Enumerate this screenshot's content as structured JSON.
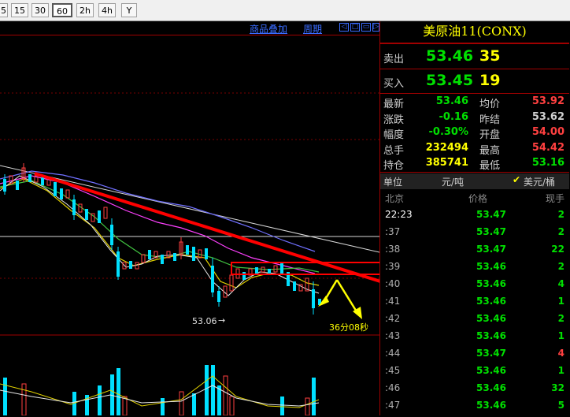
{
  "toolbar": {
    "buttons": [
      "5",
      "15",
      "30",
      "60",
      "2h",
      "4h",
      "Y"
    ],
    "active_index": 3
  },
  "chart_header": {
    "overlay_label": "商品叠加",
    "period_label": "周期"
  },
  "annotations": {
    "low_label": "53.06",
    "countdown": "36分08秒"
  },
  "panel": {
    "title": "美原油11(CONX)",
    "ask": {
      "label": "卖出",
      "price": "53.46",
      "qty": "35"
    },
    "bid": {
      "label": "买入",
      "price": "53.45",
      "qty": "19"
    },
    "stats": [
      {
        "l1": "最新",
        "v1": "53.46",
        "c1": "#00e000",
        "l2": "均价",
        "v2": "53.92",
        "c2": "#ff4040"
      },
      {
        "l1": "涨跌",
        "v1": "-0.16",
        "c1": "#00e000",
        "l2": "昨结",
        "v2": "53.62",
        "c2": "#d0d0d0"
      },
      {
        "l1": "幅度",
        "v1": "-0.30%",
        "c1": "#00e000",
        "l2": "开盘",
        "v2": "54.00",
        "c2": "#ff4040"
      },
      {
        "l1": "总手",
        "v1": "232494",
        "c1": "#ffff00",
        "l2": "最高",
        "v2": "54.42",
        "c2": "#ff4040"
      },
      {
        "l1": "持仓",
        "v1": "385741",
        "c1": "#ffff00",
        "l2": "最低",
        "v2": "53.16",
        "c2": "#00e000"
      }
    ],
    "unit_row": {
      "label": "单位",
      "opt1": "元/吨",
      "opt2": "美元/桶"
    },
    "ticks_header": {
      "time": "北京",
      "price": "价格",
      "vol": "现手"
    },
    "ticks": [
      {
        "time": "22:23",
        "price": "53.47",
        "vol": "2",
        "vc": "#00e000"
      },
      {
        "time": ":37",
        "price": "53.47",
        "vol": "2",
        "vc": "#00e000"
      },
      {
        "time": ":38",
        "price": "53.47",
        "vol": "22",
        "vc": "#00e000"
      },
      {
        "time": ":39",
        "price": "53.46",
        "vol": "2",
        "vc": "#00e000"
      },
      {
        "time": ":40",
        "price": "53.46",
        "vol": "4",
        "vc": "#00e000"
      },
      {
        "time": ":41",
        "price": "53.46",
        "vol": "1",
        "vc": "#00e000"
      },
      {
        "time": ":42",
        "price": "53.46",
        "vol": "2",
        "vc": "#00e000"
      },
      {
        "time": ":43",
        "price": "53.46",
        "vol": "1",
        "vc": "#00e000"
      },
      {
        "time": ":44",
        "price": "53.47",
        "vol": "4",
        "vc": "#ff4040"
      },
      {
        "time": ":45",
        "price": "53.46",
        "vol": "1",
        "vc": "#00e000"
      },
      {
        "time": ":46",
        "price": "53.46",
        "vol": "32",
        "vc": "#00e000"
      },
      {
        "time": ":47",
        "price": "53.46",
        "vol": "5",
        "vc": "#00e000"
      }
    ]
  }
}
